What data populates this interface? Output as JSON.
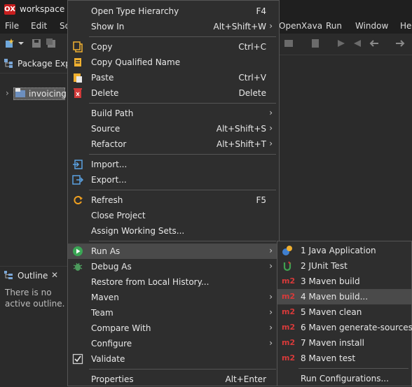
{
  "window": {
    "title": "workspace -",
    "app_icon": "OX"
  },
  "menubar": [
    "File",
    "Edit",
    "So",
    "OpenXava",
    "Run",
    "Window",
    "He"
  ],
  "package_explorer": {
    "tab_label": "Package Expl",
    "project": "invoicing"
  },
  "outline": {
    "tab_label": "Outline",
    "message": "There is no active outline."
  },
  "context_menu": {
    "items": [
      {
        "label": "Open Type Hierarchy",
        "accel": "F4"
      },
      {
        "label": "Show In",
        "accel": "Alt+Shift+W"
      },
      {
        "label": "Copy",
        "accel": "Ctrl+C"
      },
      {
        "label": "Copy Qualified Name",
        "accel": ""
      },
      {
        "label": "Paste",
        "accel": "Ctrl+V"
      },
      {
        "label": "Delete",
        "accel": "Delete"
      },
      {
        "label": "Build Path",
        "accel": ""
      },
      {
        "label": "Source",
        "accel": "Alt+Shift+S"
      },
      {
        "label": "Refactor",
        "accel": "Alt+Shift+T"
      },
      {
        "label": "Import...",
        "accel": ""
      },
      {
        "label": "Export...",
        "accel": ""
      },
      {
        "label": "Refresh",
        "accel": "F5"
      },
      {
        "label": "Close Project",
        "accel": ""
      },
      {
        "label": "Assign Working Sets...",
        "accel": ""
      },
      {
        "label": "Run As",
        "accel": ""
      },
      {
        "label": "Debug As",
        "accel": ""
      },
      {
        "label": "Restore from Local History...",
        "accel": ""
      },
      {
        "label": "Maven",
        "accel": ""
      },
      {
        "label": "Team",
        "accel": ""
      },
      {
        "label": "Compare With",
        "accel": ""
      },
      {
        "label": "Configure",
        "accel": ""
      },
      {
        "label": "Validate",
        "accel": ""
      },
      {
        "label": "Properties",
        "accel": "Alt+Enter"
      }
    ]
  },
  "run_as_submenu": {
    "items": [
      {
        "label": "1 Java Application"
      },
      {
        "label": "2 JUnit Test"
      },
      {
        "label": "3 Maven build"
      },
      {
        "label": "4 Maven build..."
      },
      {
        "label": "5 Maven clean"
      },
      {
        "label": "6 Maven generate-sources"
      },
      {
        "label": "7 Maven install"
      },
      {
        "label": "8 Maven test"
      },
      {
        "label": "Run Configurations..."
      }
    ],
    "m2_badge": "m2"
  },
  "colors": {
    "delete_red": "#d23a3a",
    "maven_red": "#d73a3a",
    "highlight": "#4a4a4a",
    "run_green": "#3aa655"
  }
}
